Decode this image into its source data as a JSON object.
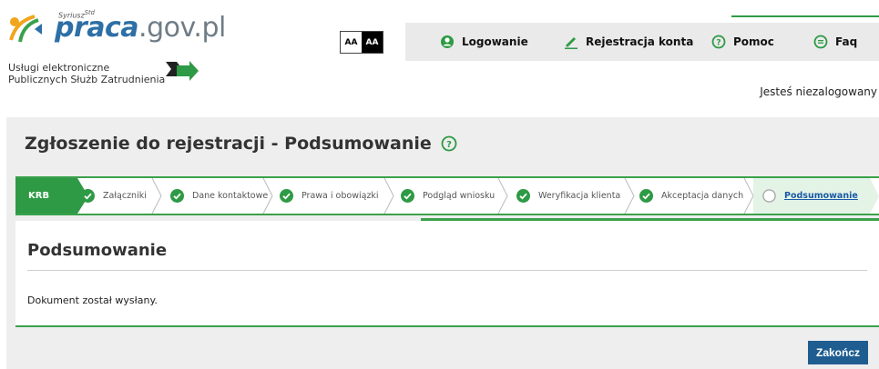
{
  "header": {
    "logo_sup": "Syriusz",
    "logo_sup_std": "Std",
    "logo_main": "praca",
    "logo_domain": ".gov.pl",
    "tagline_line1": "Usługi elektroniczne",
    "tagline_line2": "Publicznych Służb Zatrudnienia",
    "contrast_normal": "AA",
    "contrast_high": "AA",
    "login_status": "Jesteś niezalogowany"
  },
  "nav": {
    "items": [
      {
        "label": "Logowanie",
        "icon": "user-circle-icon"
      },
      {
        "label": "Rejestracja konta",
        "icon": "pencil-icon"
      },
      {
        "label": "Pomoc",
        "icon": "help-circle-icon"
      },
      {
        "label": "Faq",
        "icon": "chat-bubble-icon"
      }
    ]
  },
  "page": {
    "title": "Zgłoszenie do rejestracji - Podsumowanie"
  },
  "steps": {
    "first": "KRB",
    "items": [
      "Załączniki",
      "Dane kontaktowe",
      "Prawa i obowiązki",
      "Podgląd wniosku",
      "Weryfikacja klienta",
      "Akceptacja danych",
      "Podsumowanie"
    ]
  },
  "main": {
    "heading": "Podsumowanie",
    "message": "Dokument został wysłany.",
    "finish_button": "Zakończ"
  },
  "colors": {
    "green": "#2e9a45",
    "blue_button": "#1f5d91",
    "link_blue": "#1a5aa6",
    "panel_gray": "#eeeeee"
  }
}
